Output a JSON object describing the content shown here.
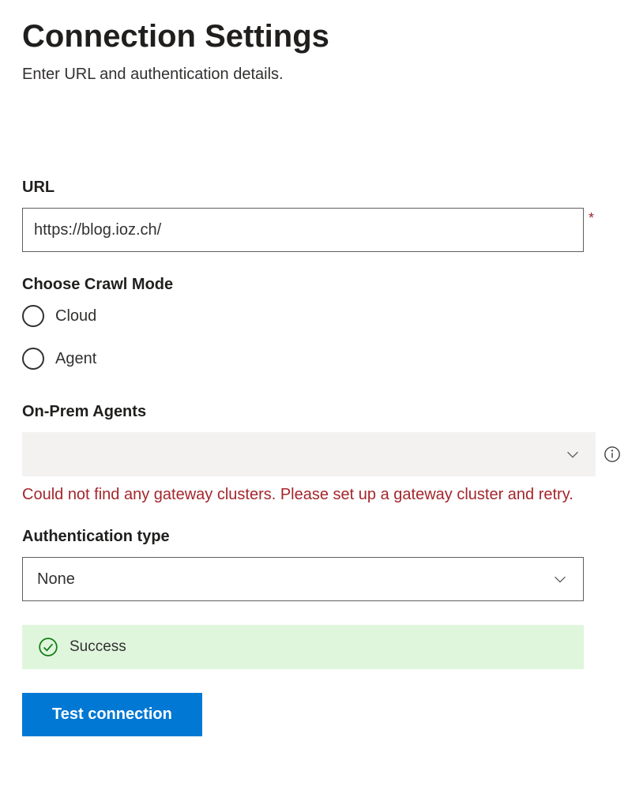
{
  "header": {
    "title": "Connection Settings",
    "subtitle": "Enter URL and authentication details."
  },
  "url": {
    "label": "URL",
    "value": "https://blog.ioz.ch/",
    "required_mark": "*"
  },
  "crawl_mode": {
    "label": "Choose Crawl Mode",
    "options": [
      "Cloud",
      "Agent"
    ]
  },
  "onprem": {
    "label": "On-Prem Agents",
    "error": "Could not find any gateway clusters. Please set up a gateway cluster and retry."
  },
  "auth": {
    "label": "Authentication type",
    "value": "None"
  },
  "status": {
    "success_text": "Success"
  },
  "actions": {
    "test_connection": "Test connection"
  }
}
